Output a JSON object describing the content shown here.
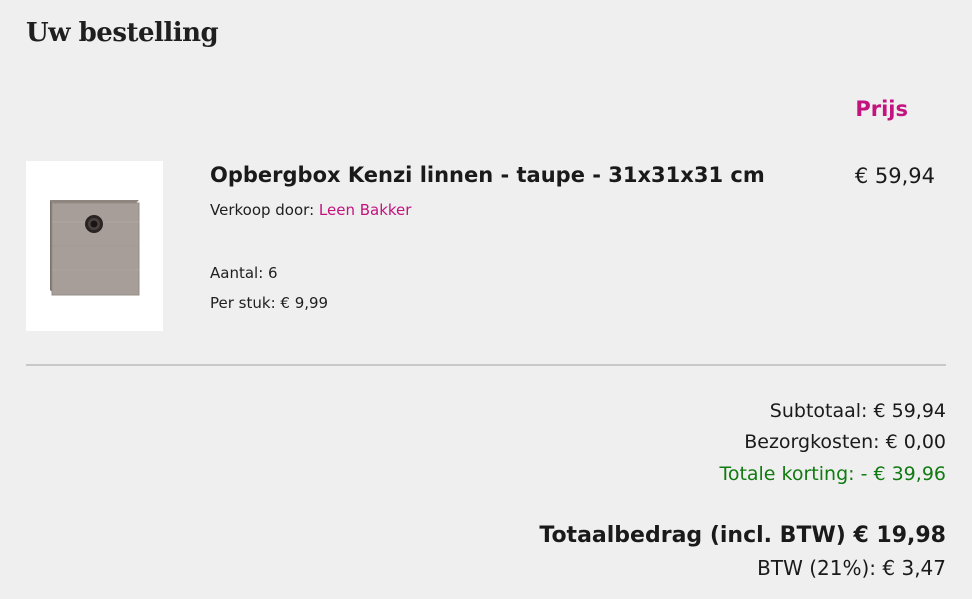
{
  "order": {
    "title": "Uw bestelling",
    "price_header": "Prijs"
  },
  "product": {
    "name": "Opbergbox Kenzi linnen - taupe - 31x31x31 cm",
    "price": "€ 59,94",
    "seller_label": "Verkoop door:",
    "seller_name": "Leen Bakker",
    "quantity": "Aantal: 6",
    "unit_price": "Per stuk: € 9,99",
    "image_icon": "storage-box-icon"
  },
  "summary": {
    "subtotal": "Subtotaal: € 59,94",
    "shipping": "Bezorgkosten: € 0,00",
    "discount": "Totale korting: - € 39,96",
    "grand_total": "Totaalbedrag (incl. BTW) € 19,98",
    "vat": "BTW (21%): € 3,47"
  },
  "colors": {
    "accent": "#c4127e",
    "discount": "#117a11",
    "background": "#efefef"
  }
}
